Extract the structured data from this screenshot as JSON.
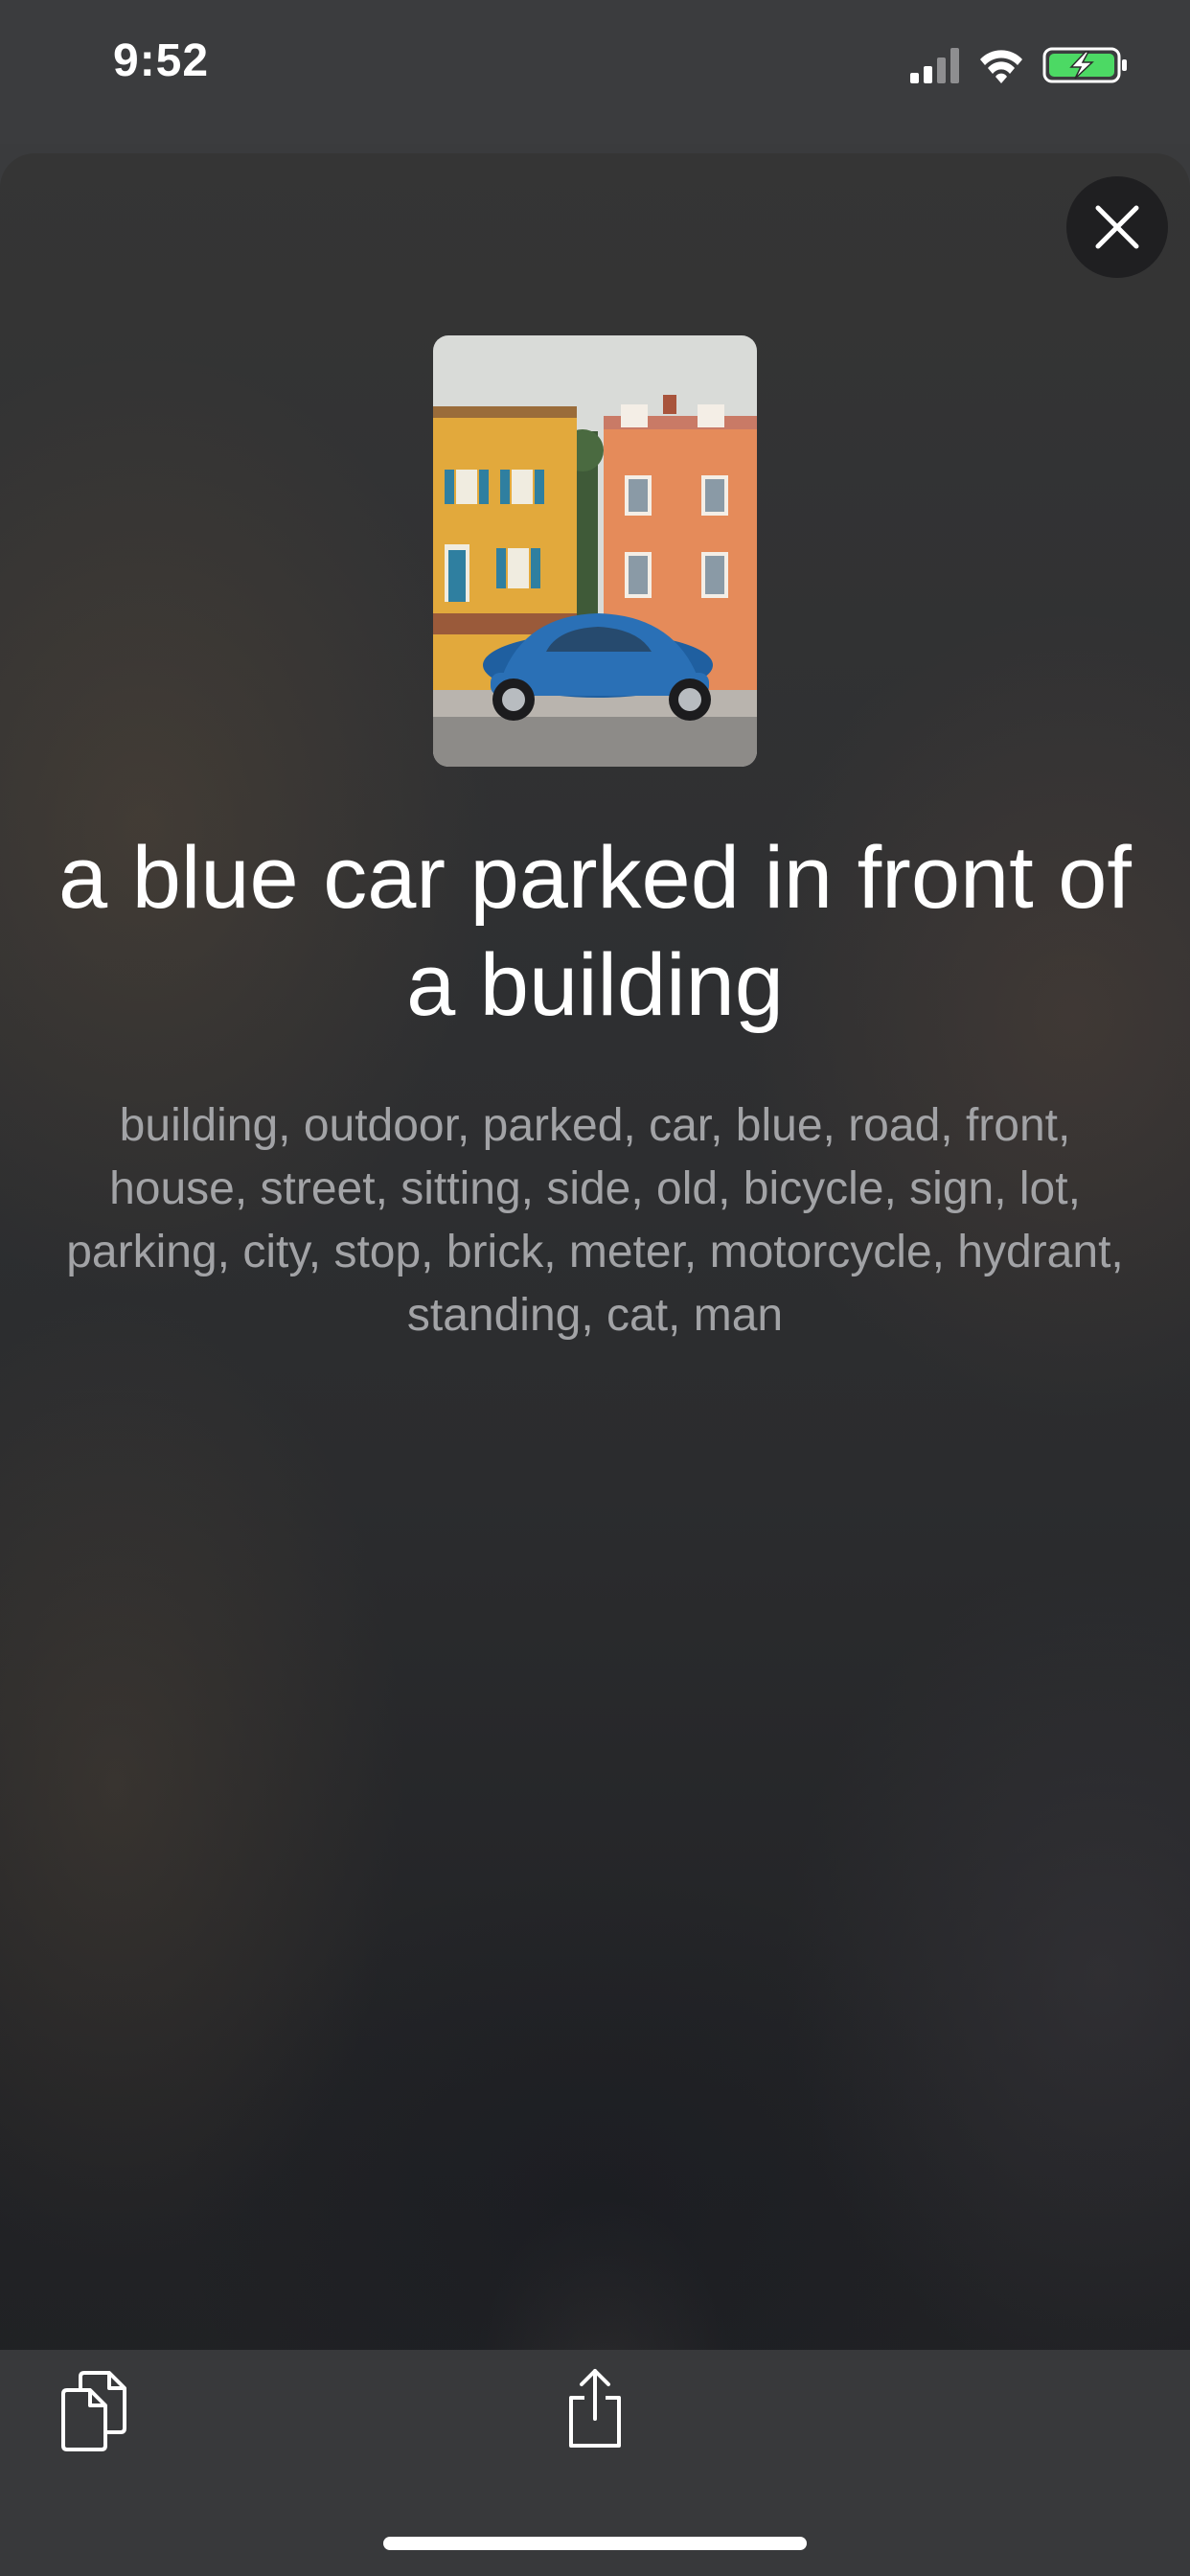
{
  "status_bar": {
    "time": "9:52",
    "battery_color": "#4cd964"
  },
  "result": {
    "caption": "a blue car parked in front of a building",
    "tags": "building, outdoor, parked, car, blue, road, front, house, street, sitting, side, old, bicycle, sign, lot, parking, city, stop, brick, meter, motorcycle, hydrant, standing, cat, man"
  },
  "icons": {
    "close": "close-icon",
    "copy": "copy-icon",
    "share": "share-icon",
    "signal": "cellular-signal-icon",
    "wifi": "wifi-icon",
    "battery": "battery-charging-icon"
  }
}
